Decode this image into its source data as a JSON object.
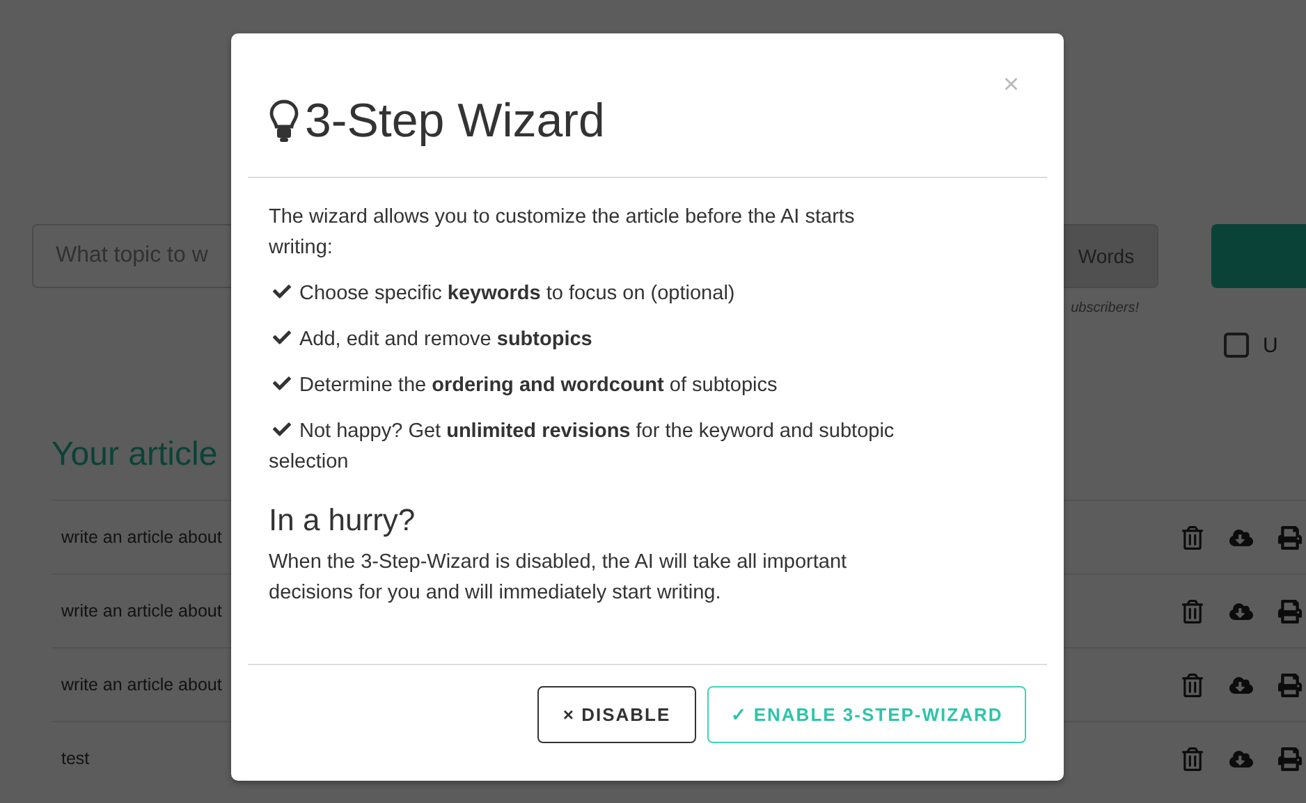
{
  "page": {
    "topic_field": {
      "placeholder": "What topic to w"
    },
    "words_label": "Words",
    "note": "ubscribers!",
    "option": {
      "label": "U",
      "checked": false
    },
    "articles_heading": "Your article",
    "articles": [
      {
        "title": "write an article about"
      },
      {
        "title": "write an article about"
      },
      {
        "title": "write an article about"
      },
      {
        "title": "test"
      }
    ]
  },
  "dialog": {
    "close": "×",
    "title": "3-Step Wizard",
    "intro": "The wizard allows you to customize the article before the AI starts writing:",
    "features": [
      "Choose specific **keywords** to focus on (optional)",
      "Add, edit and remove **subtopics**",
      "Determine the **ordering and wordcount** of subtopics",
      "Not happy? Get **unlimited revisions** for the keyword and subtopic selection"
    ],
    "section_heading": "In a hurry?",
    "section_text": "When the 3-Step-Wizard is disabled, the AI will take all important decisions for you and will immediately start writing.",
    "buttons": [
      {
        "kind": "secondary",
        "label": "× DISABLE"
      },
      {
        "kind": "primary",
        "label": "✓ ENABLE 3-STEP-WIZARD"
      }
    ]
  }
}
